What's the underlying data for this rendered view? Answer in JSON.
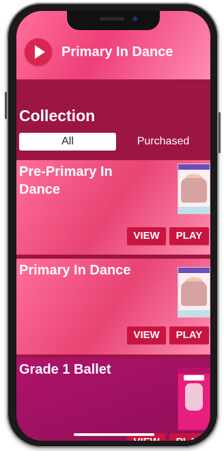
{
  "header": {
    "app_title": "Primary In Dance",
    "logo_icon": "play-icon"
  },
  "collection": {
    "title": "Collection",
    "tabs": [
      {
        "label": "All",
        "selected": true
      },
      {
        "label": "Purchased",
        "selected": false
      }
    ]
  },
  "cards": [
    {
      "title": "Pre-Primary In Dance",
      "view_label": "VIEW",
      "play_label": "PLAY"
    },
    {
      "title": "Primary In Dance",
      "view_label": "VIEW",
      "play_label": "PLAY"
    },
    {
      "title": "Grade 1 Ballet",
      "view_label": "VIEW",
      "play_label": "PLAY"
    }
  ],
  "colors": {
    "accent": "#c8153f",
    "header_pink": "#ef3f78",
    "band_dark": "#9d1542",
    "card_magenta": "#9f1262"
  }
}
